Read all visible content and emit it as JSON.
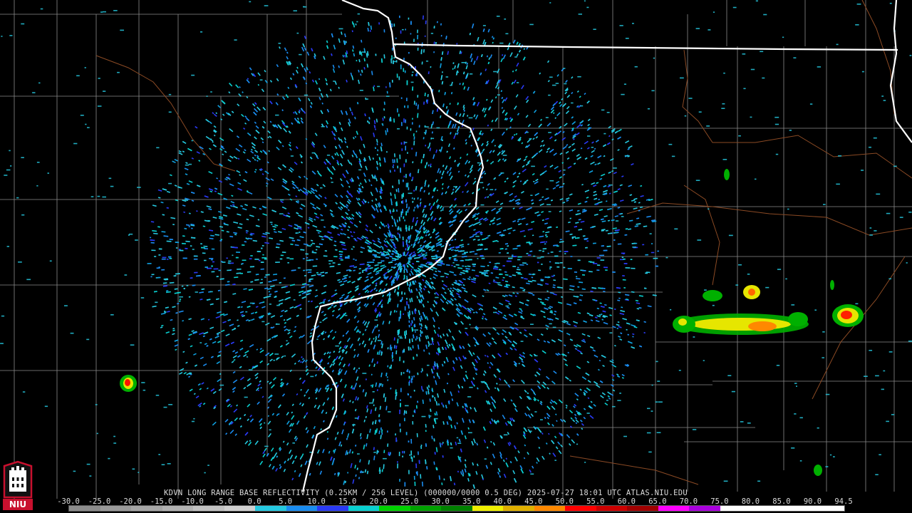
{
  "station": "KDVN",
  "caption": "KDVN LONG RANGE BASE REFLECTIVITY (0.25KM / 256 LEVEL) (000000/0000 0.5 DEG) 2025-07-27 18:01 UTC  ATLAS.NIU.EDU",
  "logo_text": "NIU",
  "scale": {
    "ticks": [
      "-30.0",
      "-25.0",
      "-20.0",
      "-15.0",
      "-10.0",
      "-5.0",
      "0.0",
      "5.0",
      "10.0",
      "15.0",
      "20.0",
      "25.0",
      "30.0",
      "35.0",
      "40.0",
      "45.0",
      "50.0",
      "55.0",
      "60.0",
      "65.0",
      "70.0",
      "75.0",
      "80.0",
      "85.0",
      "90.0",
      "94.5"
    ],
    "colors": [
      "#8c8c8c",
      "#9a9a9a",
      "#a6a6a6",
      "#b3b3b3",
      "#c2c2c2",
      "#d0d0d0",
      "#25c9e0",
      "#1a8cf0",
      "#2a3af5",
      "#09d0d0",
      "#00d100",
      "#00a000",
      "#008000",
      "#f0f000",
      "#e0b000",
      "#ff8800",
      "#ff0000",
      "#cc0000",
      "#a00000",
      "#ff00ff",
      "#aa00dd",
      "#ffffff",
      "#ffffff",
      "#ffffff",
      "#ffffff"
    ]
  },
  "colors": {
    "background": "#000000",
    "county_lines": "#8a8a8a",
    "state_lines": "#ffffff",
    "rivers": "#8b4a24",
    "logo_red": "#c8102e"
  }
}
